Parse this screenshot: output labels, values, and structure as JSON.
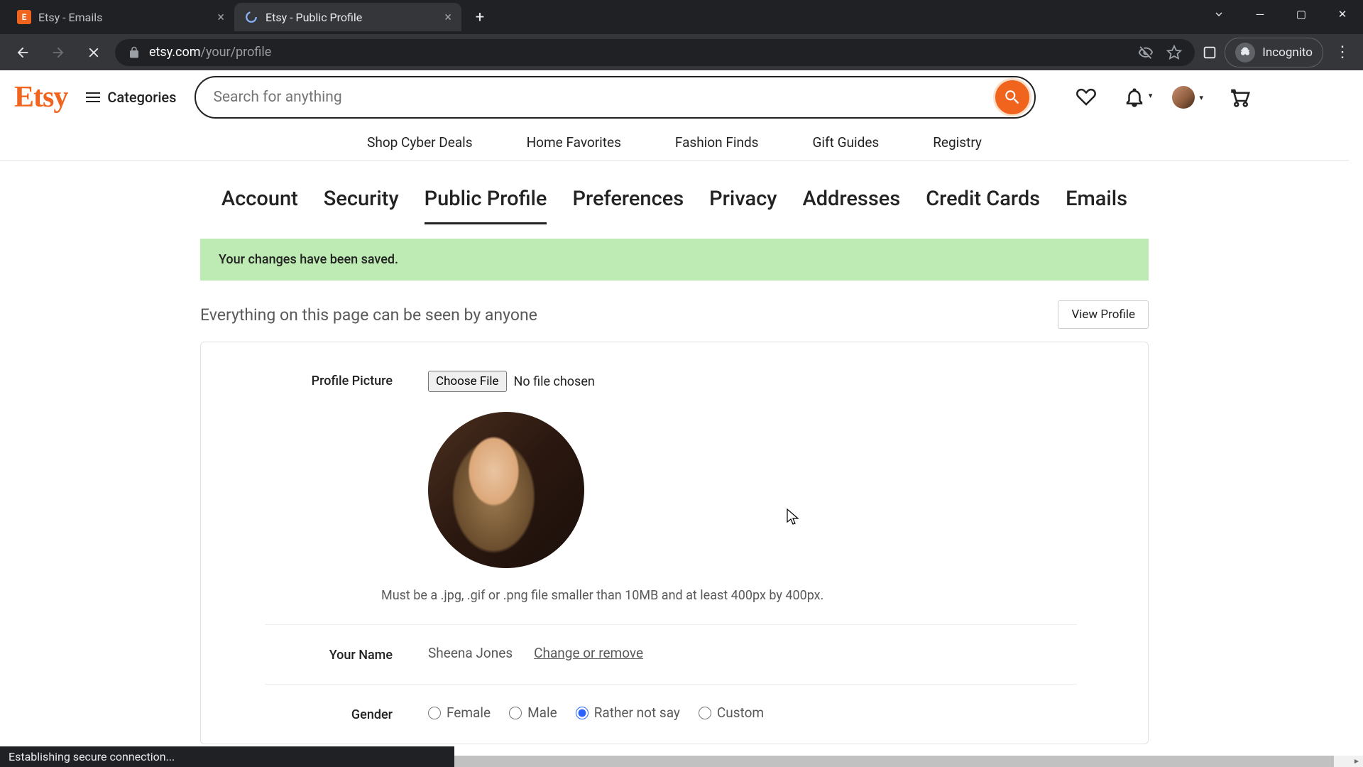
{
  "browser": {
    "tabs": [
      {
        "title": "Etsy - Emails",
        "active": false
      },
      {
        "title": "Etsy - Public Profile",
        "active": true
      }
    ],
    "url_domain": "etsy.com",
    "url_path": "/your/profile",
    "incognito_label": "Incognito",
    "status_text": "Establishing secure connection..."
  },
  "header": {
    "logo": "Etsy",
    "categories_label": "Categories",
    "search_placeholder": "Search for anything",
    "nav_links": [
      "Shop Cyber Deals",
      "Home Favorites",
      "Fashion Finds",
      "Gift Guides",
      "Registry"
    ]
  },
  "settings": {
    "tabs": [
      "Account",
      "Security",
      "Public Profile",
      "Preferences",
      "Privacy",
      "Addresses",
      "Credit Cards",
      "Emails"
    ],
    "active_tab": "Public Profile",
    "banner_text": "Your changes have been saved.",
    "subheading": "Everything on this page can be seen by anyone",
    "view_profile_label": "View Profile"
  },
  "form": {
    "profile_picture": {
      "label": "Profile Picture",
      "choose_file_label": "Choose File",
      "no_file_text": "No file chosen",
      "hint": "Must be a .jpg, .gif or .png file smaller than 10MB and at least 400px by 400px."
    },
    "name": {
      "label": "Your Name",
      "value": "Sheena Jones",
      "change_link": "Change or remove"
    },
    "gender": {
      "label": "Gender",
      "options": [
        "Female",
        "Male",
        "Rather not say",
        "Custom"
      ],
      "selected": "Rather not say"
    }
  }
}
